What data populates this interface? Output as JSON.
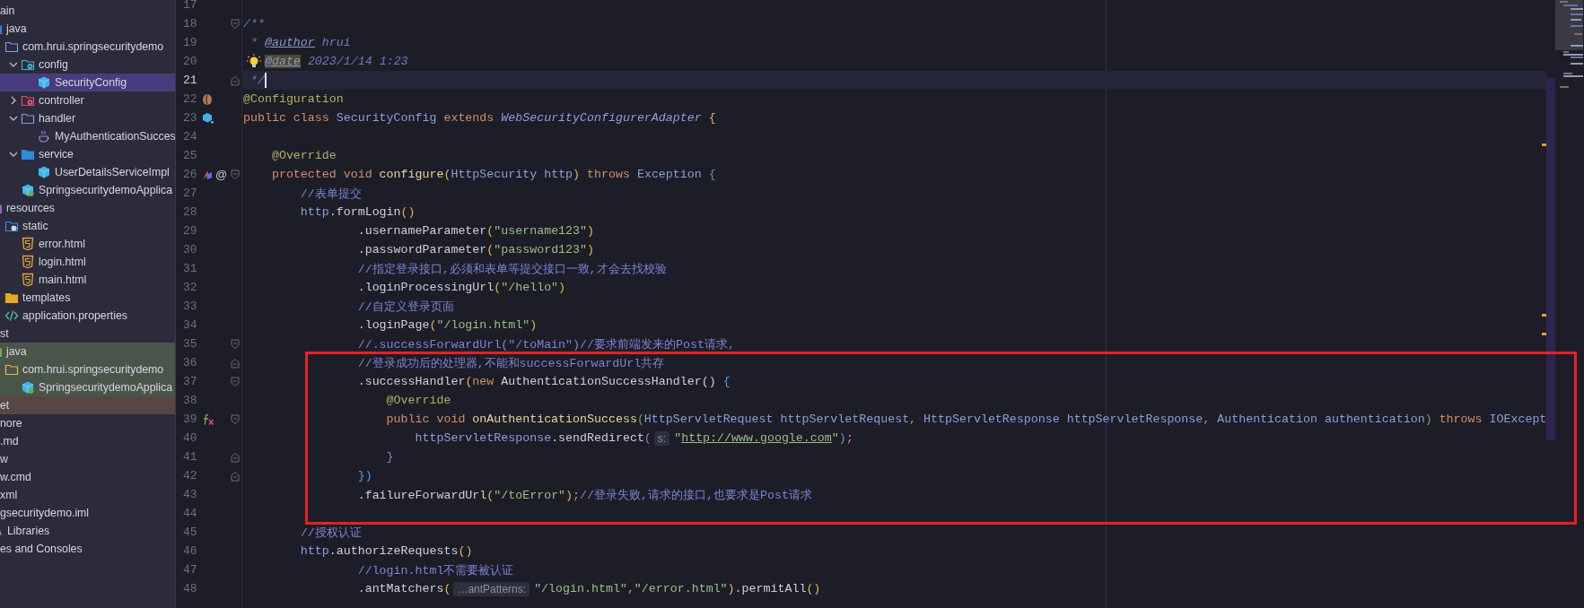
{
  "project_tree": {
    "items": [
      {
        "label": "ain",
        "selected": false,
        "children": [
          {
            "label": "java",
            "kind": "source-root",
            "selected": false,
            "children": [
              {
                "label": "com.hrui.springsecuritydemo",
                "kind": "package",
                "selected": false,
                "children": [
                  {
                    "label": "config",
                    "kind": "package-config",
                    "expanded": true,
                    "selected": false,
                    "children": [
                      {
                        "label": "SecurityConfig",
                        "kind": "class",
                        "selected": true
                      }
                    ]
                  },
                  {
                    "label": "controller",
                    "kind": "package-controller",
                    "expanded": false,
                    "selected": false
                  },
                  {
                    "label": "handler",
                    "kind": "package",
                    "expanded": true,
                    "selected": false,
                    "children": [
                      {
                        "label": "MyAuthenticationSucces",
                        "kind": "java-file",
                        "selected": false
                      }
                    ]
                  },
                  {
                    "label": "service",
                    "kind": "package-service",
                    "expanded": true,
                    "selected": false,
                    "children": [
                      {
                        "label": "UserDetailsServiceImpl",
                        "kind": "class",
                        "selected": false
                      }
                    ]
                  },
                  {
                    "label": "SpringsecuritydemoApplica",
                    "kind": "spring-app",
                    "selected": false
                  }
                ]
              }
            ]
          },
          {
            "label": "resources",
            "kind": "resources",
            "selected": false,
            "children": [
              {
                "label": "static",
                "kind": "web-folder",
                "selected": false,
                "children": [
                  {
                    "label": "error.html",
                    "kind": "html",
                    "selected": false
                  },
                  {
                    "label": "login.html",
                    "kind": "html",
                    "selected": false
                  },
                  {
                    "label": "main.html",
                    "kind": "html",
                    "selected": false
                  }
                ]
              },
              {
                "label": "templates",
                "kind": "templates",
                "selected": false
              },
              {
                "label": "application.properties",
                "kind": "properties",
                "selected": false
              }
            ]
          }
        ]
      },
      {
        "label": "st",
        "selected": false,
        "children": [
          {
            "label": "java",
            "kind": "test-root",
            "color": "#4a5549",
            "selected": false,
            "children": [
              {
                "label": "com.hrui.springsecuritydemo",
                "kind": "test-package",
                "color": "#4a5549",
                "selected": false,
                "children": [
                  {
                    "label": "SpringsecuritydemoApplica",
                    "kind": "test-class",
                    "color": "#4a5549",
                    "selected": false
                  }
                ]
              }
            ]
          }
        ]
      },
      {
        "label": "et",
        "color": "#574744",
        "selected": false
      },
      {
        "label": "nore",
        "selected": false
      },
      {
        "label": ".md",
        "selected": false
      },
      {
        "label": "w",
        "selected": false
      },
      {
        "label": "w.cmd",
        "selected": false
      },
      {
        "label": "xml",
        "selected": false
      },
      {
        "label": "gsecuritydemo.iml",
        "selected": false
      },
      {
        "label": "Libraries",
        "kind": "library",
        "selected": false
      },
      {
        "label": "es and Consoles",
        "selected": false
      }
    ]
  },
  "editor": {
    "line_groups": [
      {
        "boxed": false,
        "lines": [
          {
            "number": "17",
            "current": false
          },
          {
            "number": "18",
            "current": false,
            "fold": {
              "kind": "open"
            },
            "tokens": [
              {
                "kind": "doc",
                "text": "/**"
              }
            ]
          },
          {
            "number": "19",
            "current": false,
            "tokens": [
              {
                "kind": "doc",
                "text": " * "
              },
              {
                "kind": "doctag",
                "text": "@author"
              },
              {
                "kind": "doc",
                "text": " hrui"
              }
            ]
          },
          {
            "number": "20",
            "current": false,
            "tokens": [
              {
                "kind": "intention"
              },
              {
                "kind": "doctag-hl",
                "text": "@date"
              },
              {
                "kind": "doc",
                "text": " 2023/1/14 1:23"
              }
            ]
          },
          {
            "number": "21",
            "current": true,
            "fold": {
              "kind": "close"
            },
            "tokens": [
              {
                "kind": "doc",
                "text": " */"
              },
              {
                "kind": "caret"
              }
            ]
          },
          {
            "number": "22",
            "current": false,
            "marker": {
              "kind": "bean"
            },
            "tokens": [
              {
                "kind": "annotation",
                "text": "@Configuration"
              }
            ]
          },
          {
            "number": "23",
            "current": false,
            "marker": {
              "kind": "implements"
            },
            "tokens": [
              {
                "kind": "kw",
                "text": "public class "
              },
              {
                "kind": "type",
                "text": "SecurityConfig"
              },
              {
                "kind": "kw",
                "text": " extends "
              },
              {
                "kind": "type-italic",
                "text": "WebSecurityConfigurerAdapter"
              },
              {
                "kind": "bracket1",
                "text": " {"
              }
            ]
          },
          {
            "number": "24",
            "current": false
          },
          {
            "number": "25",
            "current": false,
            "tokens": [
              {
                "kind": "annotation",
                "text": "    @Override"
              }
            ]
          },
          {
            "number": "26",
            "current": false,
            "fold": {
              "kind": "open"
            },
            "marker": {
              "kind": "overrides",
              "text": "@"
            },
            "tokens": [
              {
                "kind": "kw",
                "text": "    protected void "
              },
              {
                "kind": "method",
                "text": "configure"
              },
              {
                "kind": "bracket1",
                "text": "("
              },
              {
                "kind": "type",
                "text": "HttpSecurity"
              },
              {
                "kind": "param",
                "text": " http"
              },
              {
                "kind": "bracket1",
                "text": ")"
              },
              {
                "kind": "kw",
                "text": " throws "
              },
              {
                "kind": "type",
                "text": "Exception "
              },
              {
                "kind": "bracket3",
                "text": "{"
              }
            ]
          },
          {
            "number": "27",
            "current": false,
            "tokens": [
              {
                "kind": "comment",
                "text": "        //表单提交"
              }
            ]
          },
          {
            "number": "28",
            "current": false,
            "tokens": [
              {
                "kind": "param",
                "text": "        http"
              },
              {
                "kind": "plain",
                "text": ".formLogin"
              },
              {
                "kind": "bracket1",
                "text": "()"
              }
            ]
          },
          {
            "number": "29",
            "current": false,
            "tokens": [
              {
                "kind": "plain",
                "text": "                .usernameParameter"
              },
              {
                "kind": "bracket1",
                "text": "("
              },
              {
                "kind": "string",
                "text": "\"username123\""
              },
              {
                "kind": "bracket1",
                "text": ")"
              }
            ]
          },
          {
            "number": "30",
            "current": false,
            "tokens": [
              {
                "kind": "plain",
                "text": "                .passwordParameter"
              },
              {
                "kind": "bracket1",
                "text": "("
              },
              {
                "kind": "string",
                "text": "\"password123\""
              },
              {
                "kind": "bracket1",
                "text": ")"
              }
            ]
          },
          {
            "number": "31",
            "current": false,
            "tokens": [
              {
                "kind": "comment",
                "text": "                //指定登录接口,必须和表单等提交接口一致,才会去找校验"
              }
            ]
          },
          {
            "number": "32",
            "current": false,
            "tokens": [
              {
                "kind": "plain",
                "text": "                .loginProcessingUrl"
              },
              {
                "kind": "bracket1",
                "text": "("
              },
              {
                "kind": "string",
                "text": "\"/hello\""
              },
              {
                "kind": "bracket1",
                "text": ")"
              }
            ]
          },
          {
            "number": "33",
            "current": false,
            "tokens": [
              {
                "kind": "comment",
                "text": "                //自定义登录页面"
              }
            ]
          },
          {
            "number": "34",
            "current": false,
            "tokens": [
              {
                "kind": "plain",
                "text": "                .loginPage"
              },
              {
                "kind": "bracket1",
                "text": "("
              },
              {
                "kind": "string",
                "text": "\"/login.html\""
              },
              {
                "kind": "bracket1",
                "text": ")"
              }
            ]
          },
          {
            "number": "35",
            "current": false,
            "fold": {
              "kind": "open"
            },
            "tokens": [
              {
                "kind": "comment",
                "text": "                //.successForwardUrl(\"/toMain\")//要求前端发来的Post请求,"
              }
            ]
          }
        ]
      },
      {
        "boxed": true,
        "lines": [
          {
            "number": "36",
            "current": false,
            "fold": {
              "kind": "close"
            },
            "tokens": [
              {
                "kind": "comment",
                "text": "                //登录成功后的处理器,不能和successForwardUrl共存"
              }
            ]
          },
          {
            "number": "37",
            "current": false,
            "fold": {
              "kind": "open"
            },
            "tokens": [
              {
                "kind": "plain",
                "text": "                .successHandler"
              },
              {
                "kind": "bracket1",
                "text": "("
              },
              {
                "kind": "kw",
                "text": "new "
              },
              {
                "kind": "plain",
                "text": "AuthenticationSuccessHandler() "
              },
              {
                "kind": "bracket2",
                "text": "{"
              }
            ]
          },
          {
            "number": "38",
            "current": false,
            "tokens": [
              {
                "kind": "annotation",
                "text": "                    @Override"
              }
            ]
          },
          {
            "number": "39",
            "current": false,
            "fold": {
              "kind": "open"
            },
            "marker": {
              "kind": "lambda"
            },
            "tokens": [
              {
                "kind": "kw",
                "text": "                    public void "
              },
              {
                "kind": "method",
                "text": "onAuthenticationSuccess"
              },
              {
                "kind": "bracket3",
                "text": "("
              },
              {
                "kind": "type",
                "text": "HttpServletRequest"
              },
              {
                "kind": "param",
                "text": " httpServletRequest"
              },
              {
                "kind": "punct",
                "text": ", "
              },
              {
                "kind": "type",
                "text": "HttpServletResponse"
              },
              {
                "kind": "param",
                "text": " httpServletResponse"
              },
              {
                "kind": "punct",
                "text": ", "
              },
              {
                "kind": "type",
                "text": "Authentication"
              },
              {
                "kind": "param",
                "text": " authentication"
              },
              {
                "kind": "bracket3",
                "text": ")"
              },
              {
                "kind": "kw",
                "text": " throws "
              },
              {
                "kind": "type",
                "text": "IOExcept"
              }
            ]
          },
          {
            "number": "40",
            "current": false,
            "tokens": [
              {
                "kind": "param",
                "text": "                        httpServletResponse"
              },
              {
                "kind": "plain",
                "text": ".sendRedirect"
              },
              {
                "kind": "bracket4",
                "text": "("
              },
              {
                "kind": "hint",
                "text": "s:"
              },
              {
                "kind": "string",
                "text": "\""
              },
              {
                "kind": "link",
                "text": "http://www.google.com"
              },
              {
                "kind": "string",
                "text": "\""
              },
              {
                "kind": "bracket4",
                "text": ")"
              },
              {
                "kind": "punct",
                "text": ";"
              }
            ]
          },
          {
            "number": "41",
            "current": false,
            "fold": {
              "kind": "close"
            },
            "tokens": [
              {
                "kind": "bracket4",
                "text": "                    }"
              }
            ]
          },
          {
            "number": "42",
            "current": false,
            "fold": {
              "kind": "close"
            },
            "tokens": [
              {
                "kind": "bracket2",
                "text": "                })"
              }
            ]
          },
          {
            "number": "43",
            "current": false,
            "tokens": [
              {
                "kind": "plain",
                "text": "                .failureForwardUrl"
              },
              {
                "kind": "bracket1",
                "text": "("
              },
              {
                "kind": "string",
                "text": "\"/toError\""
              },
              {
                "kind": "bracket1",
                "text": ")"
              },
              {
                "kind": "punct",
                "text": ";"
              },
              {
                "kind": "comment",
                "text": "//登录失败,请求的接口,也要求是Post请求"
              }
            ]
          },
          {
            "number": "44",
            "current": false
          }
        ]
      },
      {
        "boxed": false,
        "lines": [
          {
            "number": "45",
            "current": false,
            "tokens": [
              {
                "kind": "comment",
                "text": "        //授权认证"
              }
            ]
          },
          {
            "number": "46",
            "current": false,
            "tokens": [
              {
                "kind": "param",
                "text": "        http"
              },
              {
                "kind": "plain",
                "text": ".authorizeRequests"
              },
              {
                "kind": "bracket1",
                "text": "()"
              }
            ]
          },
          {
            "number": "47",
            "current": false,
            "tokens": [
              {
                "kind": "comment",
                "text": "                //login.html不需要被认证"
              }
            ]
          },
          {
            "number": "48",
            "current": false,
            "tokens": [
              {
                "kind": "plain",
                "text": "                .antMatchers"
              },
              {
                "kind": "bracket1",
                "text": "("
              },
              {
                "kind": "hint",
                "text": "…antPatterns:"
              },
              {
                "kind": "string",
                "text": "\"/login.html\""
              },
              {
                "kind": "punct",
                "text": ","
              },
              {
                "kind": "string",
                "text": "\"/error.html\""
              },
              {
                "kind": "bracket1",
                "text": ")"
              },
              {
                "kind": "plain",
                "text": ".permitAll"
              },
              {
                "kind": "bracket1",
                "text": "()"
              }
            ]
          }
        ]
      }
    ]
  }
}
